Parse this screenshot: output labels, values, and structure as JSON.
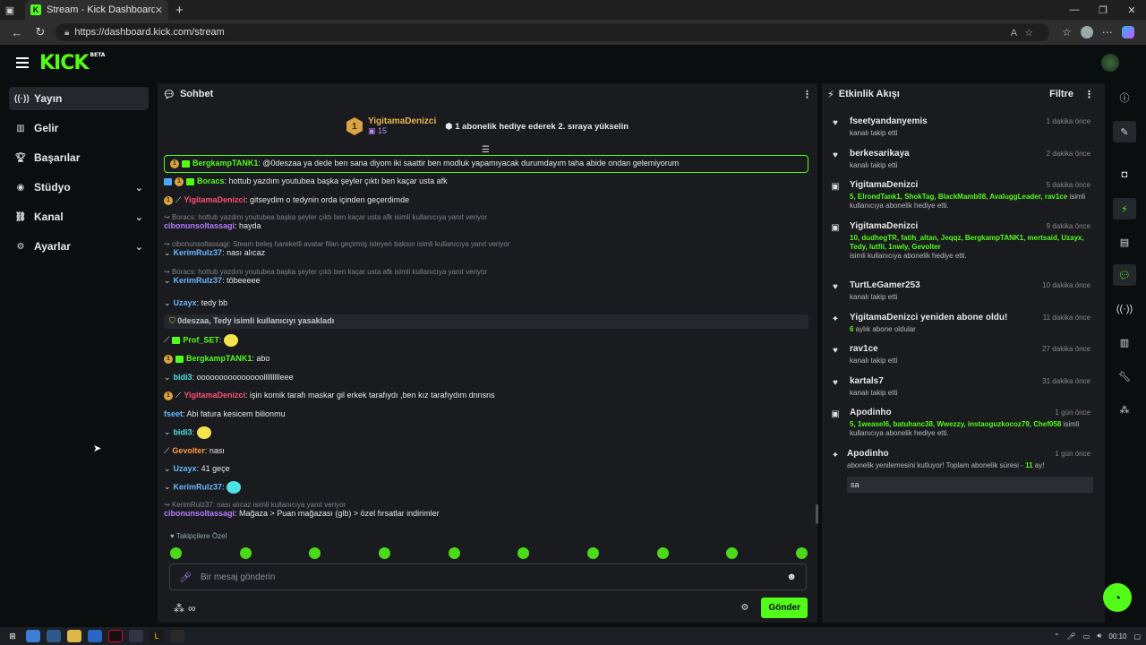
{
  "browser": {
    "tab_title": "Stream - Kick Dashboard",
    "tab_icon": "K",
    "url": "https://dashboard.kick.com/stream"
  },
  "brand": {
    "logo": "KICK",
    "beta": "BETA",
    "accent": "#53fc18"
  },
  "sidebar": {
    "items": [
      {
        "label": "Yayın",
        "icon": "broadcast-icon"
      },
      {
        "label": "Gelir",
        "icon": "revenue-icon"
      },
      {
        "label": "Başarılar",
        "icon": "trophy-icon"
      },
      {
        "label": "Stüdyo",
        "icon": "studio-icon"
      },
      {
        "label": "Kanal",
        "icon": "channel-icon"
      },
      {
        "label": "Ayarlar",
        "icon": "gear-icon"
      }
    ]
  },
  "chat": {
    "title": "Sohbet",
    "pinned": {
      "rank": "1",
      "user": "YigitamaDenizci",
      "subs": "15",
      "message": "1 abonelik hediye ederek 2. sıraya yükselin"
    },
    "messages": {
      "m1_user": "BergkampTANK1",
      "m1_text": ": @0deszaa ya dede ben sana diyom iki saattir ben modluk yapamıyacak durumdayım taha abide ondan gelemiyorum",
      "m2_user": "Boracs",
      "m2_text": ": hottub yazdım youtubea başka şeyler çıktı ben kaçar usta afk",
      "m3_user": "YigitamaDenizci",
      "m3_text": ": gitseydim o tedynin orda içinden geçerdimde",
      "m4_reply": "Boracs: hottub yazdım youtubea başka şeyler çıktı ben kaçar usta afk isimli kullanıcıya yanıt veriyor",
      "m4_user": "cibonunsoltassagi",
      "m4_text": ": hayda",
      "m5_reply": "cibonunsoltassagi:  Steam beleş hareketli avatar filan geçirmiş isteyen baksın  isimli kullanıcıya yanıt veriyor",
      "m5_user": "KerimRulz37",
      "m5_text": ": nası alıcaz",
      "m6_reply": "Boracs: hottub yazdım youtubea başka şeyler çıktı ben kaçar usta afk isimli kullanıcıya yanıt veriyor",
      "m6_user": "KerimRulz37",
      "m6_text": ": töbeeeee",
      "m7_user": "Uzayx",
      "m7_text": ": tedy bb",
      "m8_text": "0deszaa, Tedy isimli kullanıcıyı yasakladı",
      "m9_user": "Prof_SET",
      "m9_text": ":",
      "m10_user": "BergkampTANK1",
      "m10_text": ": abo",
      "m11_user": "bidi3",
      "m11_text": ": ooooooooooooooollllllllleee",
      "m12_user": "YigitamaDenizci",
      "m12_text": ": işin komik tarafı maskar gil erkek tarafıydı ,ben kız tarafıydım dnnsns",
      "m13_user": "fseet",
      "m13_text": ": Abi fatura kesicem bilionmu",
      "m14_user": "bidi3",
      "m14_text": ":",
      "m15_user": "Gevolter",
      "m15_text": ": nası",
      "m16_user": "Uzayx",
      "m16_text": ": 41 geçe",
      "m17_user": "KerimRulz37",
      "m17_text": ":",
      "m18_reply": "KerimRulz37: nası alıcaz isimli kullanıcıya yanıt veriyor",
      "m18_user": "cibonunsoltassagi",
      "m18_text": ": Mağaza > Puan mağazası (glb) > özel fırsatlar indirimler"
    },
    "followers_only": "Takipçilere Özel",
    "input_placeholder": "Bir mesaj gönderin",
    "send_label": "Gönder"
  },
  "activity": {
    "title": "Etkinlik Akışı",
    "filter_label": "Filtre",
    "events": [
      {
        "name": "fseetyandanyemis",
        "time": "1 dakika önce",
        "desc": "kanalı takip etti",
        "icon": "heart-icon"
      },
      {
        "name": "berkesarikaya",
        "time": "2 dakika önce",
        "desc": "kanalı takip etti",
        "icon": "heart-icon"
      },
      {
        "name": "YigitamaDenizci",
        "time": "5 dakika önce",
        "gift": "5, ElrondTank1, ShokTag, BlackMamb08, AvaluggLeader, rav1ce",
        "gift_suffix": " isimli kullanıcıya abonelik hediye etti.",
        "icon": "gift-icon"
      },
      {
        "name": "YigitamaDenizci",
        "time": "9 dakika önce",
        "gift": "10, dudhegTR, fatih_altan, Jeqqz, BergkampTANK1, mertsaid, Uzayx, Tedy, lutfii, 1nwly, Gevolter",
        "gift_suffix": "isimli kullanıcıya abonelik hediye etti.",
        "icon": "gift-icon"
      },
      {
        "name": "TurtLeGamer253",
        "time": "10 dakika önce",
        "desc": "kanalı takip etti",
        "icon": "heart-icon"
      },
      {
        "name": "YigitamaDenizci yeniden abone oldu!",
        "time": "11 dakika önce",
        "months": "6",
        "desc": " aylık abone oldular",
        "icon": "sparkle-icon"
      },
      {
        "name": "rav1ce",
        "time": "27 dakika önce",
        "desc": "kanalı takip etti",
        "icon": "heart-icon"
      },
      {
        "name": "kartals7",
        "time": "31 dakika önce",
        "desc": "kanalı takip etti",
        "icon": "heart-icon"
      },
      {
        "name": "Apodinho",
        "time": "1 gün önce",
        "gift": "5, 1weasel6, batuhanc38, Wwezzy, instaoguzkocoz79, Chef058",
        "gift_suffix": " isimli kullanıcıya abonelik hediye etti.",
        "icon": "gift-icon"
      },
      {
        "name": "Apodinho",
        "time": "1 gün önce",
        "desc": "abonelik yenilemesini kutluyor! Toplam abonelik süresi - ",
        "months": "11",
        "desc2": " ay!",
        "message": "sa",
        "icon": "sparkle-icon"
      }
    ]
  },
  "taskbar": {
    "time": "00:10"
  }
}
